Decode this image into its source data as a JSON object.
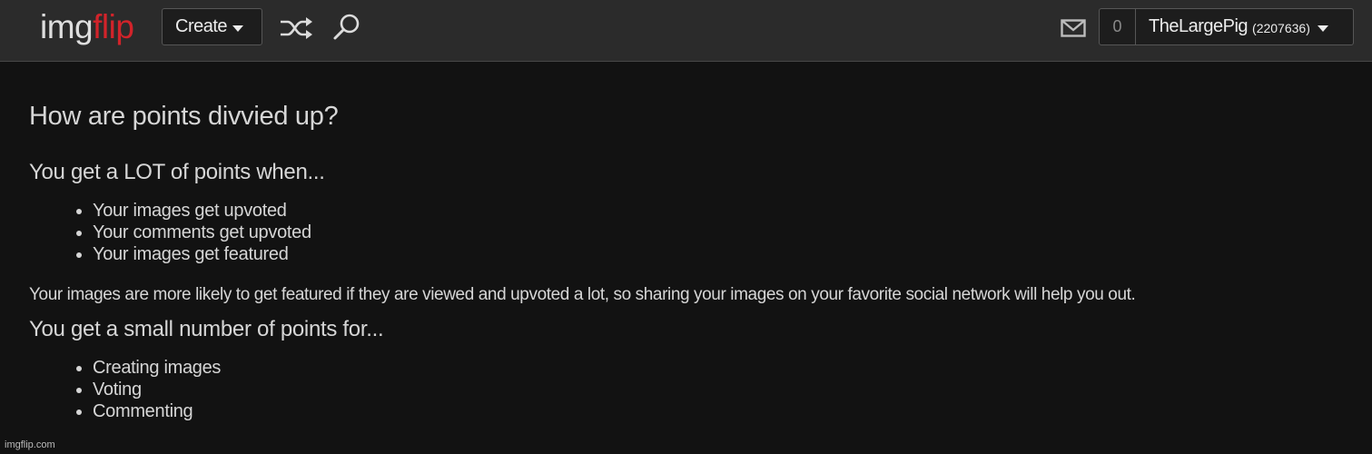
{
  "header": {
    "logo_part1": "img",
    "logo_part2": "flip",
    "create_label": "Create",
    "notification_count": "0",
    "username": "TheLargePig",
    "user_points": "(2207636)"
  },
  "colors": {
    "logo_accent": "#d2232a",
    "background": "#121212",
    "topbar": "#2b2b2b"
  },
  "content": {
    "title": "How are points divvied up?",
    "section1_heading": "You get a LOT of points when...",
    "section1_items": [
      "Your images get upvoted",
      "Your comments get upvoted",
      "Your images get featured"
    ],
    "paragraph": "Your images are more likely to get featured if they are viewed and upvoted a lot, so sharing your images on your favorite social network will help you out.",
    "section2_heading": "You get a small number of points for...",
    "section2_items": [
      "Creating images",
      "Voting",
      "Commenting"
    ]
  },
  "watermark": "imgflip.com"
}
